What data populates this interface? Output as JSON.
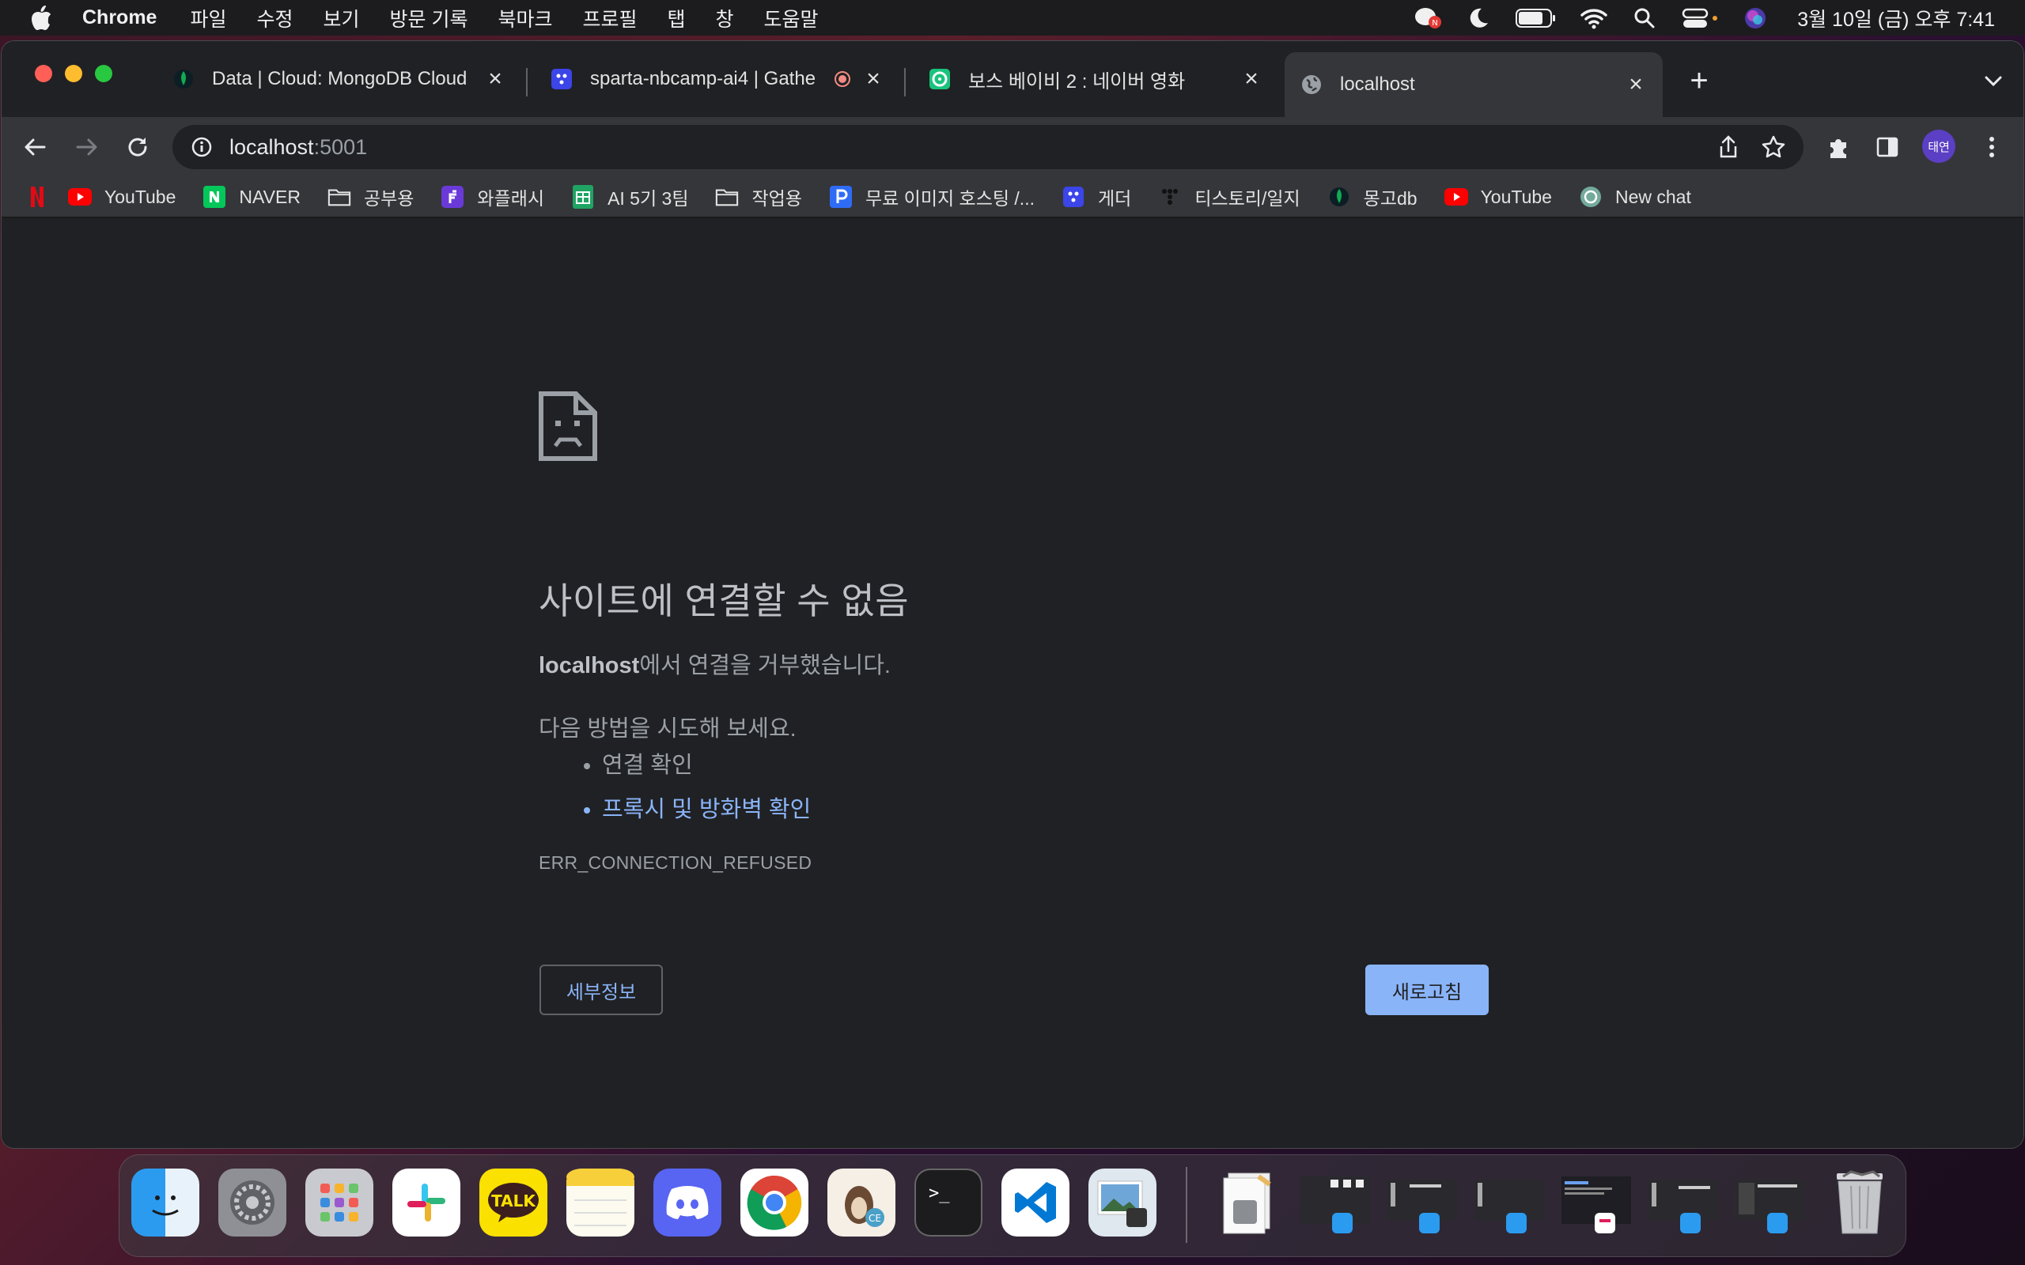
{
  "menubar": {
    "app_name": "Chrome",
    "items": [
      "파일",
      "수정",
      "보기",
      "방문 기록",
      "북마크",
      "프로필",
      "탭",
      "창",
      "도움말"
    ],
    "clock": "3월 10일 (금) 오후 7:41"
  },
  "tabs": [
    {
      "title": "Data | Cloud: MongoDB Cloud",
      "icon": "mongodb-leaf-icon"
    },
    {
      "title": "sparta-nbcamp-ai4 | Gathe",
      "icon": "gather-icon"
    },
    {
      "title": "보스 베이비 2 : 네이버 영화",
      "icon": "naver-movie-icon"
    },
    {
      "title": "localhost",
      "icon": "globe-icon",
      "active": true
    }
  ],
  "omnibox": {
    "host": "localhost",
    "port": ":5001"
  },
  "profile": {
    "initials": "태연"
  },
  "bookmarks": [
    {
      "label": "",
      "icon": "netflix-icon"
    },
    {
      "label": "YouTube",
      "icon": "youtube-icon"
    },
    {
      "label": "NAVER",
      "icon": "naver-icon"
    },
    {
      "label": "공부용",
      "icon": "folder-icon"
    },
    {
      "label": "와플래시",
      "icon": "waflash-icon"
    },
    {
      "label": "AI 5기 3팀",
      "icon": "sheet-icon"
    },
    {
      "label": "작업용",
      "icon": "folder-icon"
    },
    {
      "label": "무료 이미지 호스팅 /...",
      "icon": "hosting-icon"
    },
    {
      "label": "게더",
      "icon": "gather-icon"
    },
    {
      "label": "티스토리/일지",
      "icon": "tistory-icon"
    },
    {
      "label": "몽고db",
      "icon": "mongodb-leaf-icon"
    },
    {
      "label": "YouTube",
      "icon": "youtube-icon"
    },
    {
      "label": "New chat",
      "icon": "chatgpt-icon"
    }
  ],
  "error": {
    "title": "사이트에 연결할 수 없음",
    "host": "localhost",
    "message": "에서 연결을 거부했습니다.",
    "try_label": "다음 방법을 시도해 보세요.",
    "suggestions": [
      "연결 확인",
      "프록시 및 방화벽 확인"
    ],
    "code": "ERR_CONNECTION_REFUSED",
    "details_button": "세부정보",
    "reload_button": "새로고침"
  },
  "dock": {
    "apps": [
      "finder-icon",
      "system-settings-icon",
      "launchpad-icon",
      "slack-icon",
      "kakaotalk-icon",
      "notes-icon",
      "discord-icon",
      "chrome-icon",
      "tableplus-icon",
      "terminal-icon",
      "vscode-icon",
      "preview-icon"
    ],
    "kakaotalk_label": "TALK",
    "terminal_label": ">_",
    "minimized": 6
  },
  "colors": {
    "accent_blue": "#8ab4f8",
    "page_bg": "#202124",
    "toolbar_bg": "#35363a"
  }
}
